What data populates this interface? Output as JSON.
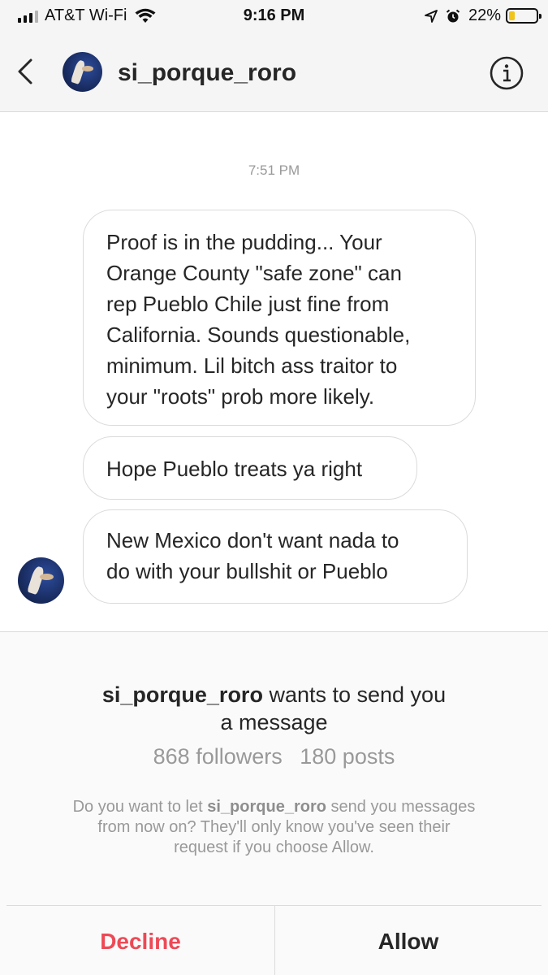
{
  "status_bar": {
    "carrier": "AT&T Wi-Fi",
    "time": "9:16 PM",
    "battery": "22%",
    "battery_level": 0.22,
    "icons": [
      "signal-icon",
      "wifi-icon",
      "location-icon",
      "alarm-icon",
      "battery-icon"
    ]
  },
  "header": {
    "username": "si_porque_roro",
    "icons": [
      "back-chevron-icon",
      "avatar",
      "info-icon"
    ]
  },
  "thread": {
    "timestamp": "7:51 PM",
    "messages": [
      {
        "lines": [
          "Proof is in the pudding... Your",
          "Orange County \"safe zone\" can",
          "rep Pueblo Chile just fine from",
          "California. Sounds questionable,",
          "minimum. Lil bitch ass traitor to",
          "your \"roots\" prob more likely."
        ]
      },
      {
        "lines": [
          "Hope Pueblo treats ya right"
        ]
      },
      {
        "lines": [
          "New Mexico don't want nada to",
          "do with your bullshit or Pueblo"
        ]
      }
    ]
  },
  "request": {
    "username": "si_porque_roro",
    "title_line1": "wants to send you",
    "title_line2": "a message",
    "followers": "868 followers",
    "posts": "180 posts",
    "desc_prefix": "Do you want to let",
    "desc_username": "si_porque_roro",
    "desc_line1_suffix": "send you messages",
    "desc_line2": "from now on? They'll only know you've seen their",
    "desc_line3": "request if you choose Allow.",
    "decline_label": "Decline",
    "allow_label": "Allow"
  },
  "colors": {
    "decline": "#ed4956",
    "battery": "#f0c419",
    "secondary_text": "#999999",
    "bubble_border": "#dbdbdb"
  }
}
